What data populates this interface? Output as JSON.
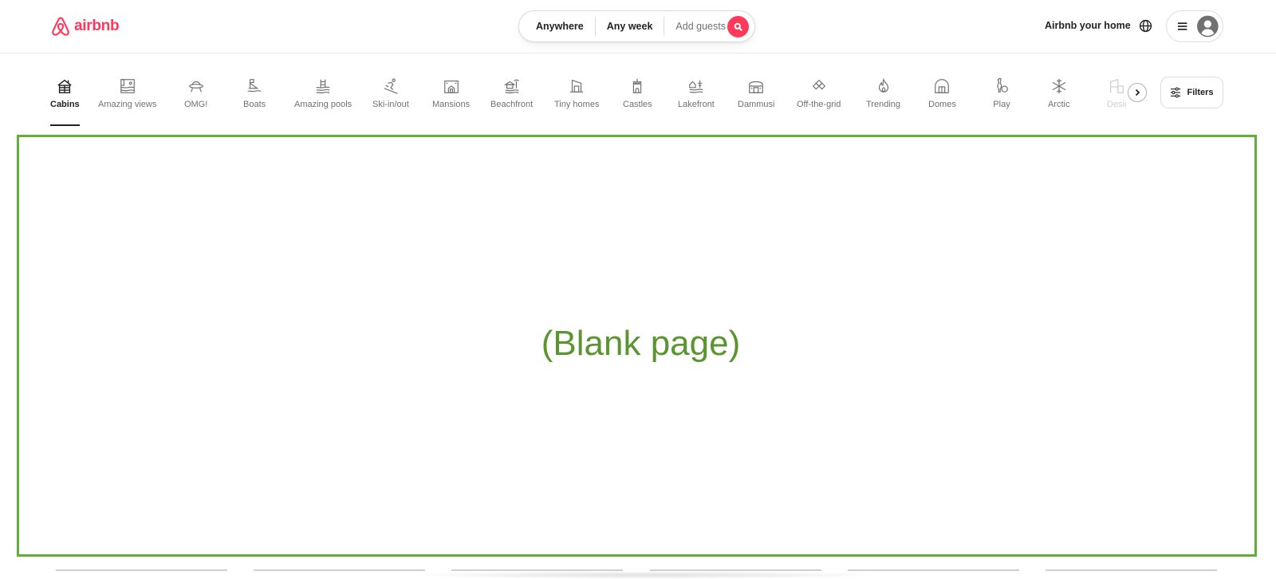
{
  "brand": {
    "name": "airbnb",
    "color": "#ff385c"
  },
  "search": {
    "location": "Anywhere",
    "dates": "Any week",
    "guests_placeholder": "Add guests",
    "button_icon": "search-icon"
  },
  "header_right": {
    "host_link": "Airbnb your home",
    "globe_icon": "globe-icon",
    "menu_icon": "hamburger-icon",
    "avatar_icon": "user-avatar-icon"
  },
  "categories": [
    {
      "label": "Cabins",
      "icon": "cabin-icon",
      "active": true
    },
    {
      "label": "Amazing views",
      "icon": "view-icon"
    },
    {
      "label": "OMG!",
      "icon": "ufo-icon"
    },
    {
      "label": "Boats",
      "icon": "boat-icon"
    },
    {
      "label": "Amazing pools",
      "icon": "pool-icon"
    },
    {
      "label": "Ski-in/out",
      "icon": "skier-icon"
    },
    {
      "label": "Mansions",
      "icon": "mansion-icon"
    },
    {
      "label": "Beachfront",
      "icon": "beach-hut-icon"
    },
    {
      "label": "Tiny homes",
      "icon": "tiny-home-icon"
    },
    {
      "label": "Castles",
      "icon": "castle-icon"
    },
    {
      "label": "Lakefront",
      "icon": "lakefront-icon"
    },
    {
      "label": "Dammusi",
      "icon": "dammuso-icon"
    },
    {
      "label": "Off-the-grid",
      "icon": "diamonds-icon"
    },
    {
      "label": "Trending",
      "icon": "flame-icon"
    },
    {
      "label": "Domes",
      "icon": "dome-icon"
    },
    {
      "label": "Play",
      "icon": "bowling-icon"
    },
    {
      "label": "Arctic",
      "icon": "snowflake-icon"
    },
    {
      "label": "Design",
      "icon": "design-icon",
      "faded": true
    }
  ],
  "filters": {
    "label": "Filters",
    "icon": "sliders-icon"
  },
  "placeholder": {
    "text": "(Blank page)",
    "color": "#5a952f",
    "border_color": "#63ad3b"
  }
}
